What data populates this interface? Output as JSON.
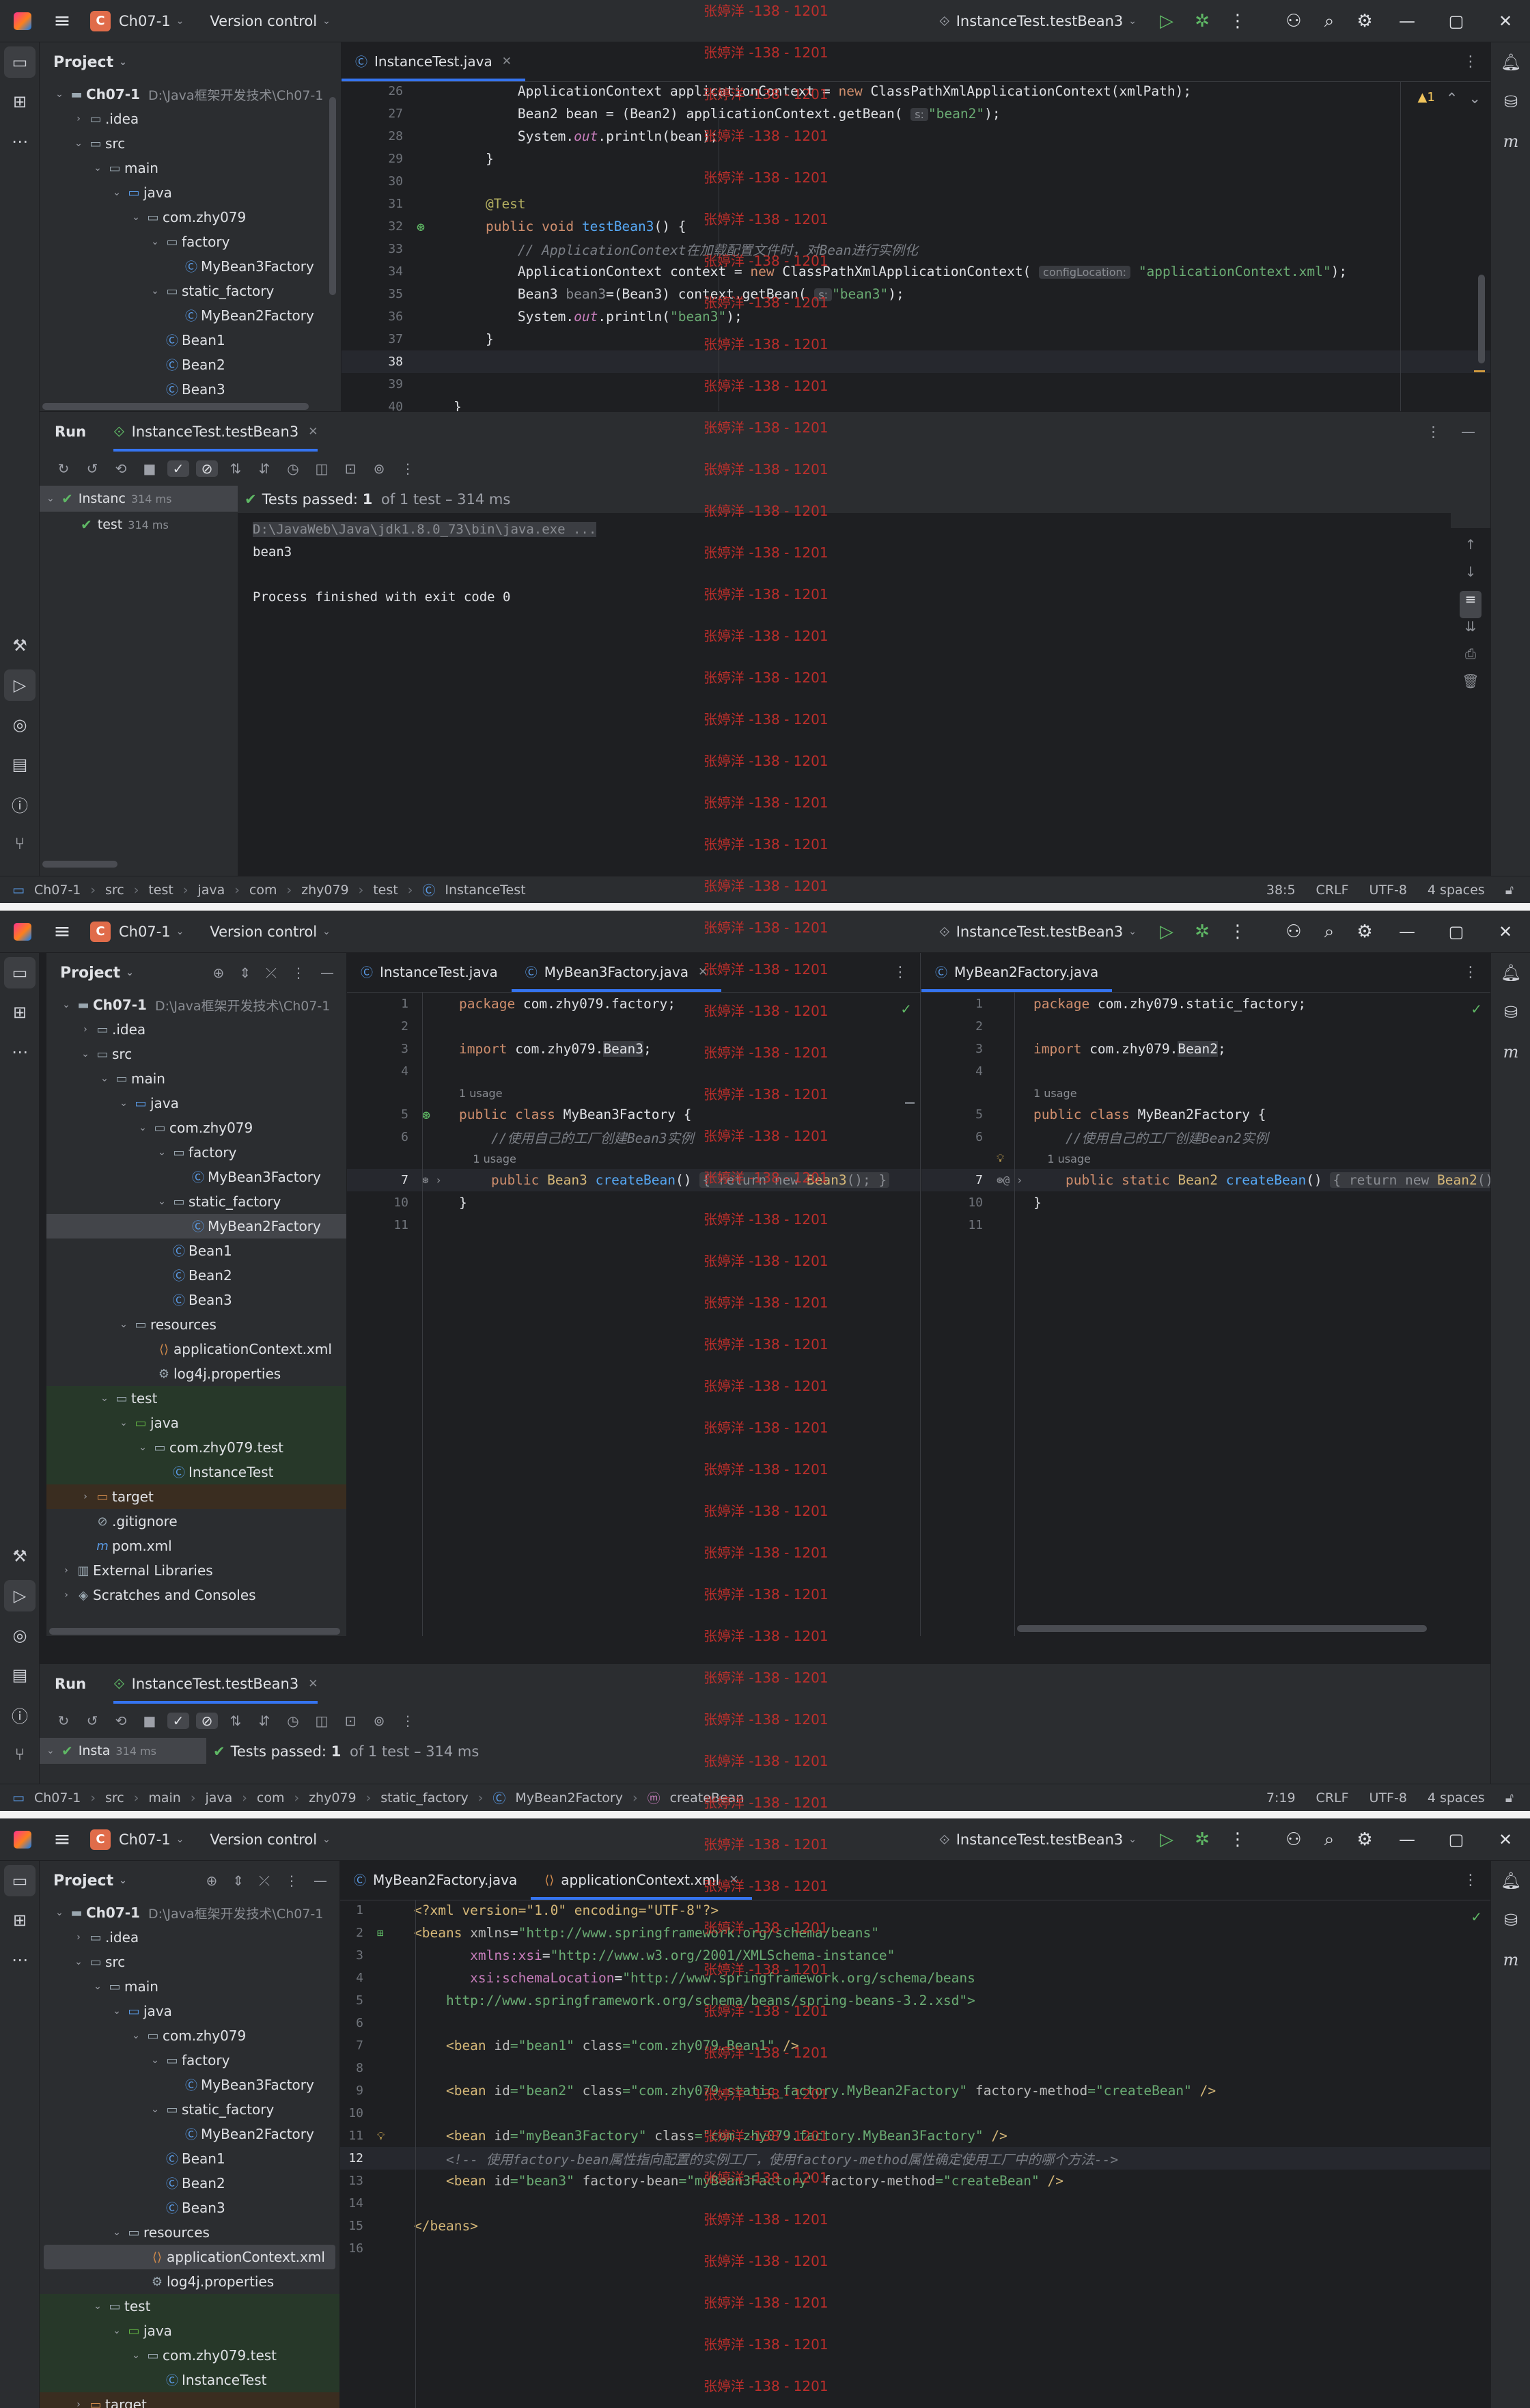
{
  "app": {
    "project": "Ch07-1",
    "project_badge": "C",
    "vc": "Version control",
    "run_config": "InstanceTest.testBean3"
  },
  "watermark": "张婷洋 -138 - 1201",
  "tree_common": {
    "project_header": "Project",
    "root": "Ch07-1",
    "root_path": "D:\\Java框架开发技术\\Ch07-1",
    "idea": ".idea",
    "src": "src",
    "main": "main",
    "java": "java",
    "pkg": "com.zhy079",
    "factory": "factory",
    "mb3f": "MyBean3Factory",
    "static_factory": "static_factory",
    "mb2f": "MyBean2Factory",
    "bean1": "Bean1",
    "bean2": "Bean2",
    "bean3": "Bean3",
    "resources": "resources",
    "appctx": "applicationContext.xml",
    "log4j": "log4j.properties",
    "test": "test",
    "test_pkg": "com.zhy079.test",
    "instancetest": "InstanceTest",
    "target": "target",
    "gitignore": ".gitignore",
    "pom": "pom.xml",
    "extlib": "External Libraries",
    "scratches": "Scratches and Consoles"
  },
  "p1": {
    "tab": "InstanceTest.java",
    "warn": "▲1",
    "lines": [
      26,
      27,
      28,
      29,
      30,
      31,
      32,
      33,
      34,
      35,
      36,
      37,
      38,
      39,
      40
    ],
    "code": {
      "l26a": "        ApplicationContext applicationContext = ",
      "l26b": "new ",
      "l26c": "ClassPathXmlApplicationContext(xmlPath);",
      "l27a": "        Bean2 bean = (Bean2) applicationContext.getBean( ",
      "l27h": "s:",
      "l27s": "\"bean2\"",
      "l27e": ");",
      "l28a": "        System.",
      "l28b": "out",
      "l28c": ".println(bean);",
      "l29": "    }",
      "l31": "    @Test",
      "l32a": "    public void ",
      "l32b": "testBean3",
      "l32c": "() {",
      "l33": "        // ApplicationContext在加载配置文件时，对Bean进行实例化",
      "l34a": "        ApplicationContext context = ",
      "l34b": "new ",
      "l34c": "ClassPathXmlApplicationContext( ",
      "l34h": "configLocation:",
      "l34s": " \"applicationContext.xml\"",
      "l34e": ");",
      "l35a": "        Bean3 ",
      "l35b": "bean3",
      "l35c": "=(Bean3) context.getBean( ",
      "l35h": "s:",
      "l35s": "\"bean3\"",
      "l35e": ");",
      "l36a": "        System.",
      "l36b": "out",
      "l36c": ".println(",
      "l36s": "\"bean3\"",
      "l36e": ");",
      "l37": "    }",
      "l40": "}"
    },
    "run_label": "Run",
    "run_tab": "InstanceTest.testBean3",
    "test_root": "Instanc",
    "test_root_ms": "314 ms",
    "test_child": "test",
    "test_child_ms": "314 ms",
    "passed": "Tests passed:",
    "passed_count": "1",
    "passed_rest": "of 1 test – 314 ms",
    "console": [
      "D:\\JavaWeb\\Java\\jdk1.8.0_73\\bin\\java.exe ...",
      "bean3",
      "",
      "Process finished with exit code 0"
    ],
    "crumbs": [
      "Ch07-1",
      "src",
      "test",
      "java",
      "com",
      "zhy079",
      "test",
      "InstanceTest"
    ],
    "status": [
      "38:5",
      "CRLF",
      "UTF-8",
      "4 spaces"
    ]
  },
  "p2": {
    "tabs_left": [
      "InstanceTest.java",
      "MyBean3Factory.java"
    ],
    "tab_right": "MyBean2Factory.java",
    "left_lines": [
      "1",
      "2",
      "3",
      "4",
      "",
      "5",
      "6",
      "",
      "7",
      "10",
      "11"
    ],
    "left": {
      "l1a": "package ",
      "l1b": "com.zhy079.factory;",
      "l3a": "import ",
      "l3b": "com.zhy079.",
      "l3c": "Bean3",
      ";": ";",
      "usage": "1 usage",
      "l5a": "public class ",
      "l5b": "MyBean3Factory {",
      "l6": "    //使用自己的工厂创建Bean3实例",
      "usage2": "1 usage",
      "l7a": "    public ",
      "l7b": "Bean3 ",
      "l7c": "createBean",
      "l7d": "() ",
      "l7e": "{ return new ",
      "l7f": "Bean3",
      "l7g": "(); }",
      "l10": "}"
    },
    "right": {
      "l1a": "package ",
      "l1b": "com.zhy079.static_factory;",
      "l3a": "import ",
      "l3b": "com.zhy079.",
      "l3c": "Bean2",
      "usage": "1 usage",
      "l5a": "public class ",
      "l5b": "MyBean2Factory {",
      "l6": "    //使用自己的工厂创建Bean2实例",
      "usage2": "1 usage",
      "l7a": "    public static ",
      "l7b": "Bean2 ",
      "l7c": "createBean",
      "l7d": "() ",
      "l7e": "{ return new ",
      "l7f": "Bean2",
      "l7g": "();",
      "l10": "}"
    },
    "run_label": "Run",
    "run_tab": "InstanceTest.testBean3",
    "test_root": "Insta",
    "test_root_ms": "314 ms",
    "passed": "Tests passed:",
    "passed_count": "1",
    "passed_rest": "of 1 test – 314 ms",
    "crumbs": [
      "Ch07-1",
      "src",
      "main",
      "java",
      "com",
      "zhy079",
      "static_factory",
      "MyBean2Factory",
      "createBean"
    ],
    "status": [
      "7:19",
      "CRLF",
      "UTF-8",
      "4 spaces"
    ]
  },
  "p3": {
    "tabs": [
      "MyBean2Factory.java",
      "applicationContext.xml"
    ],
    "lines": [
      "1",
      "2",
      "3",
      "4",
      "5",
      "6",
      "7",
      "8",
      "9",
      "10",
      "11",
      "12",
      "13",
      "14",
      "15",
      "16"
    ],
    "x": {
      "l1": "<?xml version=\"1.0\" encoding=\"UTF-8\"?>",
      "l2a": "<beans ",
      "l2b": "xmlns",
      "l2c": "=",
      "l2d": "\"http://www.springframework.org/schema/beans\"",
      "l3a": "       xmlns:xsi",
      "l3c": "=",
      "l3d": "\"http://www.w3.org/2001/XMLSchema-instance\"",
      "l4a": "       xsi:schemaLocation",
      "l4c": "=",
      "l4d": "\"http://www.springframework.org/schema/beans",
      "l5": "    http://www.springframework.org/schema/beans/spring-beans-3.2.xsd\">",
      "l7a": "    <bean ",
      "l7b": "id",
      "l7c": "=\"bean1\" ",
      "l7d": "class",
      "l7e": "=\"com.zhy079.Bean1\" ",
      "l7f": "/>",
      "l9a": "    <bean ",
      "l9b": "id",
      "l9c": "=\"bean2\" ",
      "l9d": "class",
      "l9e": "=\"com.zhy079.static_factory.MyBean2Factory\" ",
      "l9f": "factory-method",
      "l9g": "=\"createBean\" ",
      "l9h": "/>",
      "l11a": "    <bean ",
      "l11b": "id",
      "l11c": "=\"myBean3Factory\" ",
      "l11d": "class",
      "l11e": "=\"com.zhy079.factory.MyBean3Factory\" ",
      "l11f": "/>",
      "l12": "    <!-- 使用factory-bean属性指向配置的实例工厂，使用factory-method属性确定使用工厂中的哪个方法-->",
      "l13a": "    <bean ",
      "l13b": "id",
      "l13c": "=\"bean3\" ",
      "l13d": "factory-bean",
      "l13e": "=\"myBean3Factory\" ",
      "l13f": "factory-method",
      "l13g": "=\"createBean\" ",
      "l13h": "/>",
      "l15": "</beans>"
    }
  }
}
